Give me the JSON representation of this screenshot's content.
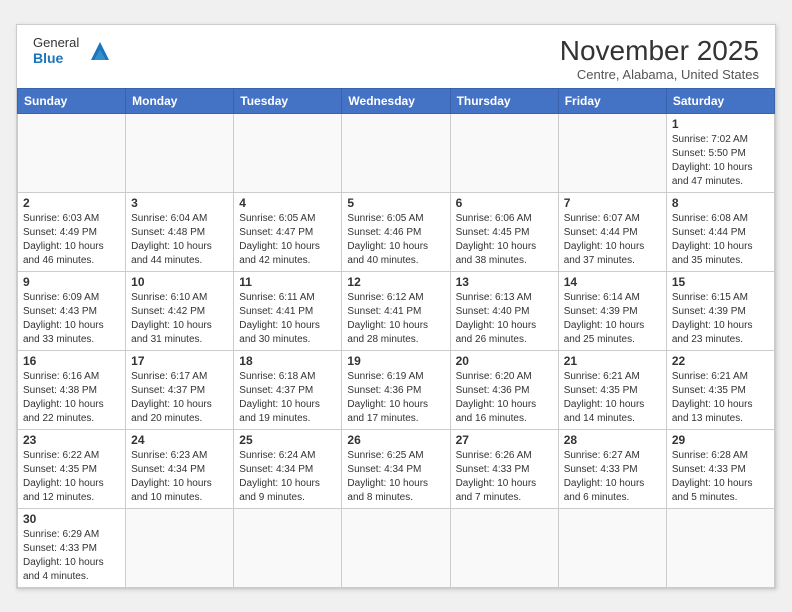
{
  "header": {
    "logo_general": "General",
    "logo_blue": "Blue",
    "month_title": "November 2025",
    "location": "Centre, Alabama, United States"
  },
  "weekdays": [
    "Sunday",
    "Monday",
    "Tuesday",
    "Wednesday",
    "Thursday",
    "Friday",
    "Saturday"
  ],
  "weeks": [
    [
      {
        "day": "",
        "info": ""
      },
      {
        "day": "",
        "info": ""
      },
      {
        "day": "",
        "info": ""
      },
      {
        "day": "",
        "info": ""
      },
      {
        "day": "",
        "info": ""
      },
      {
        "day": "",
        "info": ""
      },
      {
        "day": "1",
        "info": "Sunrise: 7:02 AM\nSunset: 5:50 PM\nDaylight: 10 hours\nand 47 minutes."
      }
    ],
    [
      {
        "day": "2",
        "info": "Sunrise: 6:03 AM\nSunset: 4:49 PM\nDaylight: 10 hours\nand 46 minutes."
      },
      {
        "day": "3",
        "info": "Sunrise: 6:04 AM\nSunset: 4:48 PM\nDaylight: 10 hours\nand 44 minutes."
      },
      {
        "day": "4",
        "info": "Sunrise: 6:05 AM\nSunset: 4:47 PM\nDaylight: 10 hours\nand 42 minutes."
      },
      {
        "day": "5",
        "info": "Sunrise: 6:05 AM\nSunset: 4:46 PM\nDaylight: 10 hours\nand 40 minutes."
      },
      {
        "day": "6",
        "info": "Sunrise: 6:06 AM\nSunset: 4:45 PM\nDaylight: 10 hours\nand 38 minutes."
      },
      {
        "day": "7",
        "info": "Sunrise: 6:07 AM\nSunset: 4:44 PM\nDaylight: 10 hours\nand 37 minutes."
      },
      {
        "day": "8",
        "info": "Sunrise: 6:08 AM\nSunset: 4:44 PM\nDaylight: 10 hours\nand 35 minutes."
      }
    ],
    [
      {
        "day": "9",
        "info": "Sunrise: 6:09 AM\nSunset: 4:43 PM\nDaylight: 10 hours\nand 33 minutes."
      },
      {
        "day": "10",
        "info": "Sunrise: 6:10 AM\nSunset: 4:42 PM\nDaylight: 10 hours\nand 31 minutes."
      },
      {
        "day": "11",
        "info": "Sunrise: 6:11 AM\nSunset: 4:41 PM\nDaylight: 10 hours\nand 30 minutes."
      },
      {
        "day": "12",
        "info": "Sunrise: 6:12 AM\nSunset: 4:41 PM\nDaylight: 10 hours\nand 28 minutes."
      },
      {
        "day": "13",
        "info": "Sunrise: 6:13 AM\nSunset: 4:40 PM\nDaylight: 10 hours\nand 26 minutes."
      },
      {
        "day": "14",
        "info": "Sunrise: 6:14 AM\nSunset: 4:39 PM\nDaylight: 10 hours\nand 25 minutes."
      },
      {
        "day": "15",
        "info": "Sunrise: 6:15 AM\nSunset: 4:39 PM\nDaylight: 10 hours\nand 23 minutes."
      }
    ],
    [
      {
        "day": "16",
        "info": "Sunrise: 6:16 AM\nSunset: 4:38 PM\nDaylight: 10 hours\nand 22 minutes."
      },
      {
        "day": "17",
        "info": "Sunrise: 6:17 AM\nSunset: 4:37 PM\nDaylight: 10 hours\nand 20 minutes."
      },
      {
        "day": "18",
        "info": "Sunrise: 6:18 AM\nSunset: 4:37 PM\nDaylight: 10 hours\nand 19 minutes."
      },
      {
        "day": "19",
        "info": "Sunrise: 6:19 AM\nSunset: 4:36 PM\nDaylight: 10 hours\nand 17 minutes."
      },
      {
        "day": "20",
        "info": "Sunrise: 6:20 AM\nSunset: 4:36 PM\nDaylight: 10 hours\nand 16 minutes."
      },
      {
        "day": "21",
        "info": "Sunrise: 6:21 AM\nSunset: 4:35 PM\nDaylight: 10 hours\nand 14 minutes."
      },
      {
        "day": "22",
        "info": "Sunrise: 6:21 AM\nSunset: 4:35 PM\nDaylight: 10 hours\nand 13 minutes."
      }
    ],
    [
      {
        "day": "23",
        "info": "Sunrise: 6:22 AM\nSunset: 4:35 PM\nDaylight: 10 hours\nand 12 minutes."
      },
      {
        "day": "24",
        "info": "Sunrise: 6:23 AM\nSunset: 4:34 PM\nDaylight: 10 hours\nand 10 minutes."
      },
      {
        "day": "25",
        "info": "Sunrise: 6:24 AM\nSunset: 4:34 PM\nDaylight: 10 hours\nand 9 minutes."
      },
      {
        "day": "26",
        "info": "Sunrise: 6:25 AM\nSunset: 4:34 PM\nDaylight: 10 hours\nand 8 minutes."
      },
      {
        "day": "27",
        "info": "Sunrise: 6:26 AM\nSunset: 4:33 PM\nDaylight: 10 hours\nand 7 minutes."
      },
      {
        "day": "28",
        "info": "Sunrise: 6:27 AM\nSunset: 4:33 PM\nDaylight: 10 hours\nand 6 minutes."
      },
      {
        "day": "29",
        "info": "Sunrise: 6:28 AM\nSunset: 4:33 PM\nDaylight: 10 hours\nand 5 minutes."
      }
    ],
    [
      {
        "day": "30",
        "info": "Sunrise: 6:29 AM\nSunset: 4:33 PM\nDaylight: 10 hours\nand 4 minutes."
      },
      {
        "day": "",
        "info": ""
      },
      {
        "day": "",
        "info": ""
      },
      {
        "day": "",
        "info": ""
      },
      {
        "day": "",
        "info": ""
      },
      {
        "day": "",
        "info": ""
      },
      {
        "day": "",
        "info": ""
      }
    ]
  ]
}
